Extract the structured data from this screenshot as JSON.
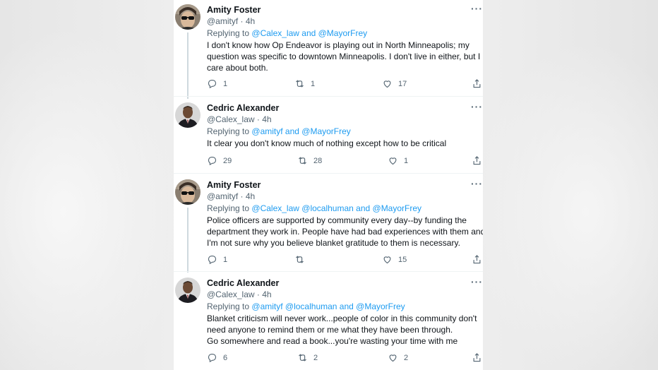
{
  "tweets": [
    {
      "name": "Amity Foster",
      "handle": "@amityf",
      "time": "4h",
      "replying_prefix": "Replying to",
      "replying_to": "@Calex_law and @MayorFrey",
      "body": "I don't know how Op Endeavor is playing out in North Minneapolis; my question was specific to downtown Minneapolis.  I don't live in either, but I care about both.",
      "replies": "1",
      "retweets": "1",
      "likes": "17",
      "avatar": "sunglasses-woman"
    },
    {
      "name": "Cedric Alexander",
      "handle": "@Calex_law",
      "time": "4h",
      "replying_prefix": "Replying to",
      "replying_to": "@amityf and @MayorFrey",
      "body": "It clear you don't know much of nothing except how to be critical",
      "replies": "29",
      "retweets": "28",
      "likes": "1",
      "avatar": "man-in-suit"
    },
    {
      "name": "Amity Foster",
      "handle": "@amityf",
      "time": "4h",
      "replying_prefix": "Replying to",
      "replying_to": "@Calex_law @localhuman and @MayorFrey",
      "body": "Police officers are supported by community every day--by funding the department they work in. People have had bad experiences with them and I'm not sure why you believe blanket gratitude to them is necessary.",
      "replies": "1",
      "retweets": "",
      "likes": "15",
      "avatar": "sunglasses-woman"
    },
    {
      "name": "Cedric Alexander",
      "handle": "@Calex_law",
      "time": "4h",
      "replying_prefix": "Replying to",
      "replying_to": "@amityf @localhuman and @MayorFrey",
      "body_lines": [
        "Blanket criticism will never work...people of color in this community don't need anyone to remind them or me what they have been through.",
        "Go somewhere and read a book...you're wasting your time with me"
      ],
      "replies": "6",
      "retweets": "2",
      "likes": "2",
      "avatar": "man-in-suit"
    }
  ],
  "separator": "·",
  "more_label": "···",
  "colors": {
    "link": "#1d9bf0",
    "secondary": "#536471",
    "text": "#0f1419"
  }
}
